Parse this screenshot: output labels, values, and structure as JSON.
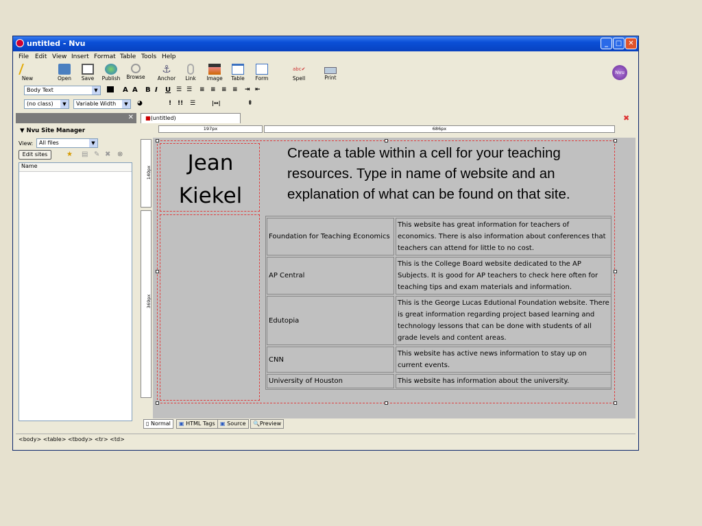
{
  "window": {
    "title": "untitled - Nvu",
    "app_logo": "nvu-icon"
  },
  "menu": [
    "File",
    "Edit",
    "View",
    "Insert",
    "Format",
    "Table",
    "Tools",
    "Help"
  ],
  "toolbar": [
    {
      "label": "New",
      "icon": "new-icon"
    },
    {
      "label": "Open",
      "icon": "open-icon"
    },
    {
      "label": "Save",
      "icon": "save-icon"
    },
    {
      "label": "Publish",
      "icon": "publish-icon"
    },
    {
      "label": "Browse",
      "icon": "browse-icon"
    },
    {
      "label": "Anchor",
      "icon": "anchor-icon"
    },
    {
      "label": "Link",
      "icon": "link-icon"
    },
    {
      "label": "Image",
      "icon": "image-icon"
    },
    {
      "label": "Table",
      "icon": "table-icon"
    },
    {
      "label": "Form",
      "icon": "form-icon"
    },
    {
      "label": "Spell",
      "icon": "spell-icon"
    },
    {
      "label": "Print",
      "icon": "print-icon"
    }
  ],
  "format": {
    "paragraph": "Body Text",
    "class": "(no class)",
    "width": "Variable Width",
    "bold": "B",
    "italic": "I",
    "underline": "U"
  },
  "sidebar": {
    "title": "Nvu Site Manager",
    "view_label": "View:",
    "view_value": "All files",
    "edit_sites": "Edit sites",
    "column": "Name"
  },
  "document": {
    "tab": "(untitled)",
    "ruler": {
      "col1": "197px",
      "col2": "686px",
      "row1": "140px",
      "row2": "369px"
    },
    "name_line1": "Jean",
    "name_line2": "Kiekel",
    "instruction": "Create a table within a cell for your teaching resources.  Type in name of website and an explanation of what can be found on that site.",
    "rows": [
      {
        "site": "Foundation for Teaching Economics",
        "desc": "This website has great information for teachers of economics.  There is also information about conferences that teachers can attend for little to no cost."
      },
      {
        "site": "AP Central",
        "desc": "This is the College Board website dedicated to the AP Subjects.  It is good for AP teachers to check here often for teaching tips and exam materials and information."
      },
      {
        "site": "Edutopia",
        "desc": "This is the George Lucas Edutional Foundation website.  There is great information regarding project based learning and technology lessons that can be done with students of all grade levels and content areas."
      },
      {
        "site": "CNN",
        "desc": "This website has active news information to stay up on current events."
      },
      {
        "site": "University of Houston",
        "desc": "This website has information about the university."
      }
    ]
  },
  "view_tabs": [
    "Normal",
    "HTML Tags",
    "Source",
    "Preview"
  ],
  "status_path": "<body> <table> <tbody> <tr> <td>",
  "colors": {
    "titlebar": "#0a4fd6",
    "desktop": "#e6e1cf",
    "cell_border": "#e03c3c"
  }
}
